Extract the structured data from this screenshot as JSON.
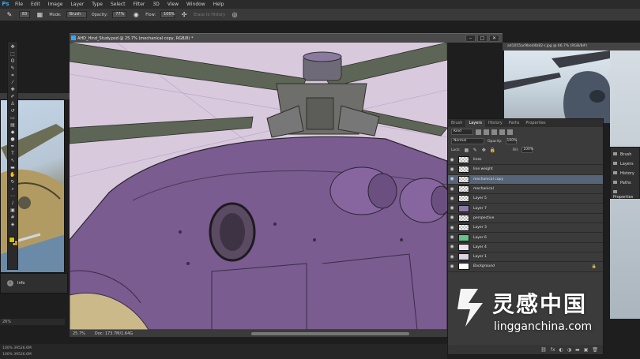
{
  "app": {
    "logo": "Ps",
    "menu": [
      "File",
      "Edit",
      "Image",
      "Layer",
      "Type",
      "Select",
      "Filter",
      "3D",
      "View",
      "Window",
      "Help"
    ]
  },
  "options": {
    "brush_size": "83",
    "mode_label": "Mode:",
    "mode_value": "Brush",
    "opacity_label": "Opacity:",
    "opacity_value": "77%",
    "flow_label": "Flow:",
    "flow_value": "100%",
    "erase_history": "Erase to History"
  },
  "main_doc": {
    "tab_title": "AHD_Hind_Study.psd @ 25.7% (mechanical copy, RGB/8) *",
    "zoom": "25.7%",
    "doc_size": "Doc: 173.7M/1.64G"
  },
  "right_doc": {
    "tab_title": "ad1055ac9bed4b82-r.jpg @ 66.7% (RGB/8#)"
  },
  "left_panel": {
    "info_label": "Info",
    "zoom": "26%",
    "status_lines": [
      "100% 39526.6M",
      "100% 39526.6M"
    ]
  },
  "mini_panels": [
    "Brush",
    "Layers",
    "History",
    "Paths",
    "Properties"
  ],
  "layers_panel": {
    "tabs": [
      "Brush",
      "Layers",
      "History",
      "Paths",
      "Properties"
    ],
    "active_tab": "Layers",
    "kind_label": "Kind",
    "blend_mode": "Normal",
    "opacity_label": "Opacity:",
    "opacity_value": "100%",
    "lock_label": "Lock:",
    "fill_label": "Fill:",
    "fill_value": "100%",
    "layers": [
      {
        "name": "lines",
        "thumb": "checker",
        "active": false
      },
      {
        "name": "line weight",
        "thumb": "checker",
        "active": false
      },
      {
        "name": "mechanical copy",
        "thumb": "checker",
        "active": true
      },
      {
        "name": "mechanical",
        "thumb": "checker",
        "active": false
      },
      {
        "name": "Layer 5",
        "thumb": "checker",
        "active": false
      },
      {
        "name": "Layer 7",
        "thumb": "#8b7aa8",
        "active": false
      },
      {
        "name": "perspective",
        "thumb": "checker",
        "active": false
      },
      {
        "name": "Layer 3",
        "thumb": "checker",
        "active": false
      },
      {
        "name": "Layer 6",
        "thumb": "#6ac08a",
        "active": false
      },
      {
        "name": "Layer 4",
        "thumb": "#e7e2ee",
        "active": false
      },
      {
        "name": "Layer 1",
        "thumb": "#dcd3e2",
        "active": false
      },
      {
        "name": "Background",
        "thumb": "#ffffff",
        "active": false
      }
    ]
  },
  "watermark": {
    "chinese": "灵感中国",
    "english": "lingganchina.com"
  },
  "colors": {
    "canvas_bg": "#d8c9dd",
    "heli_body": "#7a5c90",
    "rotor": "#5c6456",
    "foreground": "#d9c200"
  }
}
